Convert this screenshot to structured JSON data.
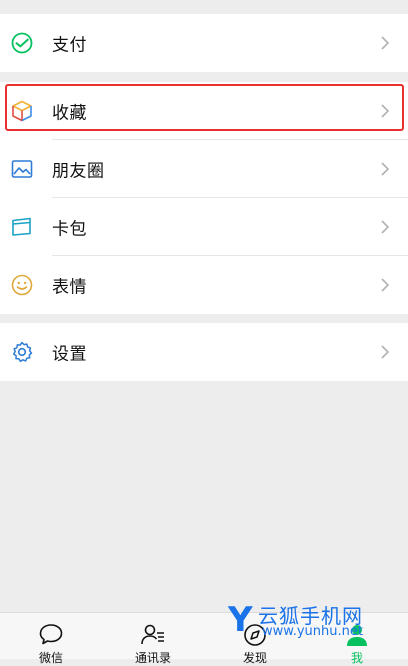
{
  "menu": {
    "group1": [
      {
        "label": "支付",
        "icon": "pay-icon"
      }
    ],
    "group2": [
      {
        "label": "收藏",
        "icon": "favorites-cube-icon"
      },
      {
        "label": "朋友圈",
        "icon": "moments-image-icon"
      },
      {
        "label": "卡包",
        "icon": "card-wallet-icon"
      },
      {
        "label": "表情",
        "icon": "smiley-icon"
      }
    ],
    "group3": [
      {
        "label": "设置",
        "icon": "gear-icon"
      }
    ]
  },
  "tabbar": {
    "tabs": [
      {
        "label": "微信",
        "icon": "chat-bubble-icon"
      },
      {
        "label": "通讯录",
        "icon": "contacts-icon"
      },
      {
        "label": "发现",
        "icon": "compass-icon"
      },
      {
        "label": "我",
        "icon": "person-icon"
      }
    ],
    "active_color": "#07c160"
  },
  "watermark": {
    "logo_letter": "Y",
    "text": "云狐手机网",
    "url": "www.yunhu.net"
  },
  "colors": {
    "highlight_border": "#e8312c",
    "pay_green": "#07c160",
    "background": "#ededed"
  }
}
